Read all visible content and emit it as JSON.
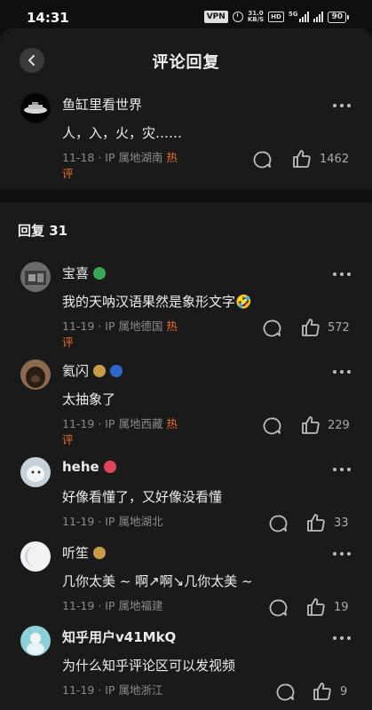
{
  "status_bar": {
    "time": "14:31",
    "vpn": "VPN",
    "speed_value": "31.0",
    "speed_unit": "KB/S",
    "hd": "HD",
    "signal_label": "5G",
    "battery": "90"
  },
  "header": {
    "title": "评论回复"
  },
  "root_comment": {
    "name": "鱼缸里看世界",
    "text": "人，入，火，灾……",
    "meta_date": "11-18 · IP 属地湖南 ",
    "meta_hot": "热",
    "meta_hot2": "评",
    "likes": "1462"
  },
  "replies_heading": "回复 31",
  "replies": [
    {
      "name": "宝喜",
      "text": "我的天呐汉语果然是象形文字🤣",
      "meta_date": "11-19 · IP 属地德国 ",
      "meta_hot": "热",
      "meta_hot2": "评",
      "likes": "572"
    },
    {
      "name": "氦闪",
      "text": "太抽象了",
      "meta_date": "11-19 · IP 属地西藏 ",
      "meta_hot": "热",
      "meta_hot2": "评",
      "likes": "229"
    },
    {
      "name": "hehe",
      "text": "好像看懂了，又好像没看懂",
      "meta_date": "11-19 · IP 属地湖北",
      "likes": "33"
    },
    {
      "name": "听笙",
      "text": "几你太美 ~ 啊↗啊↘几你太美 ~",
      "meta_date": "11-19 · IP 属地福建",
      "likes": "19"
    },
    {
      "name": "知乎用户v41MkQ",
      "text": "为什么知乎评论区可以发视频",
      "meta_date": "11-19 · IP 属地浙江",
      "likes": "9"
    }
  ],
  "colors": {
    "hot": "#e86f2d",
    "background": "#1a1a1a",
    "badge_green": "#3aa757",
    "badge_gold": "#c89b4a",
    "badge_red": "#e0445a"
  }
}
